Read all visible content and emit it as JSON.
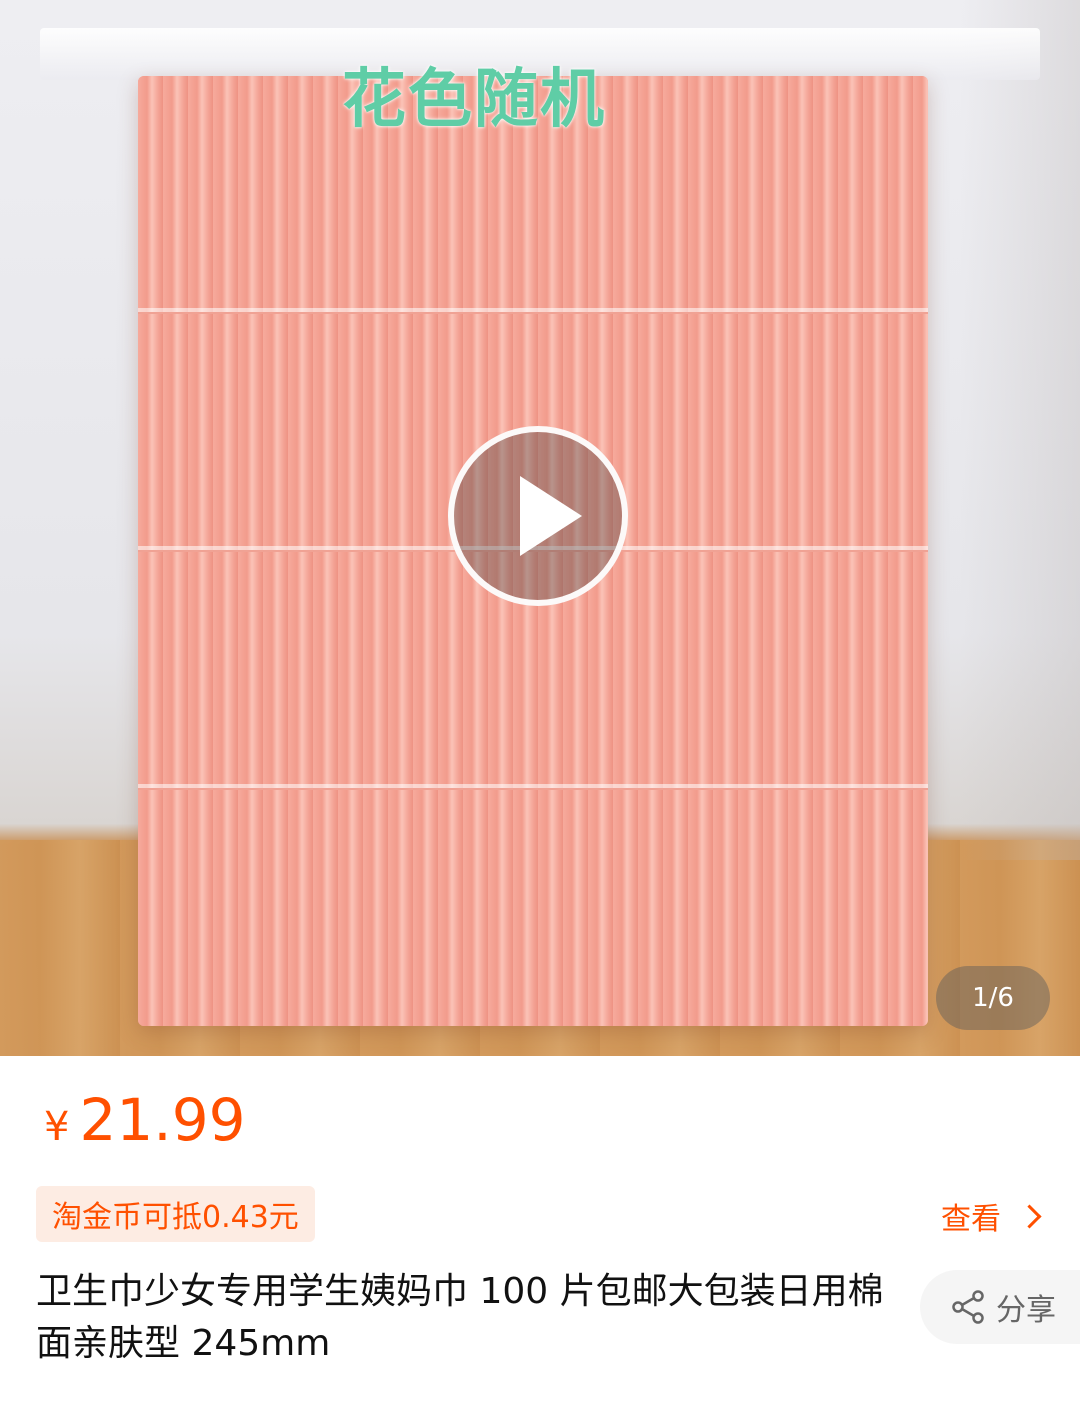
{
  "media": {
    "overlay_text": "花色随机",
    "page_indicator": "1/6"
  },
  "product": {
    "currency_symbol": "¥",
    "price": "21.99",
    "coin_deduction": "淘金币可抵0.43元",
    "view_label": "查看",
    "title": "卫生巾少女专用学生姨妈巾 100 片包邮大包装日用棉面亲肤型 245mm",
    "share_label": "分享"
  },
  "colors": {
    "accent": "#ff5000",
    "badge_bg": "#fdece3"
  },
  "icons": [
    "play-icon",
    "chevron-right-icon",
    "share-icon"
  ]
}
